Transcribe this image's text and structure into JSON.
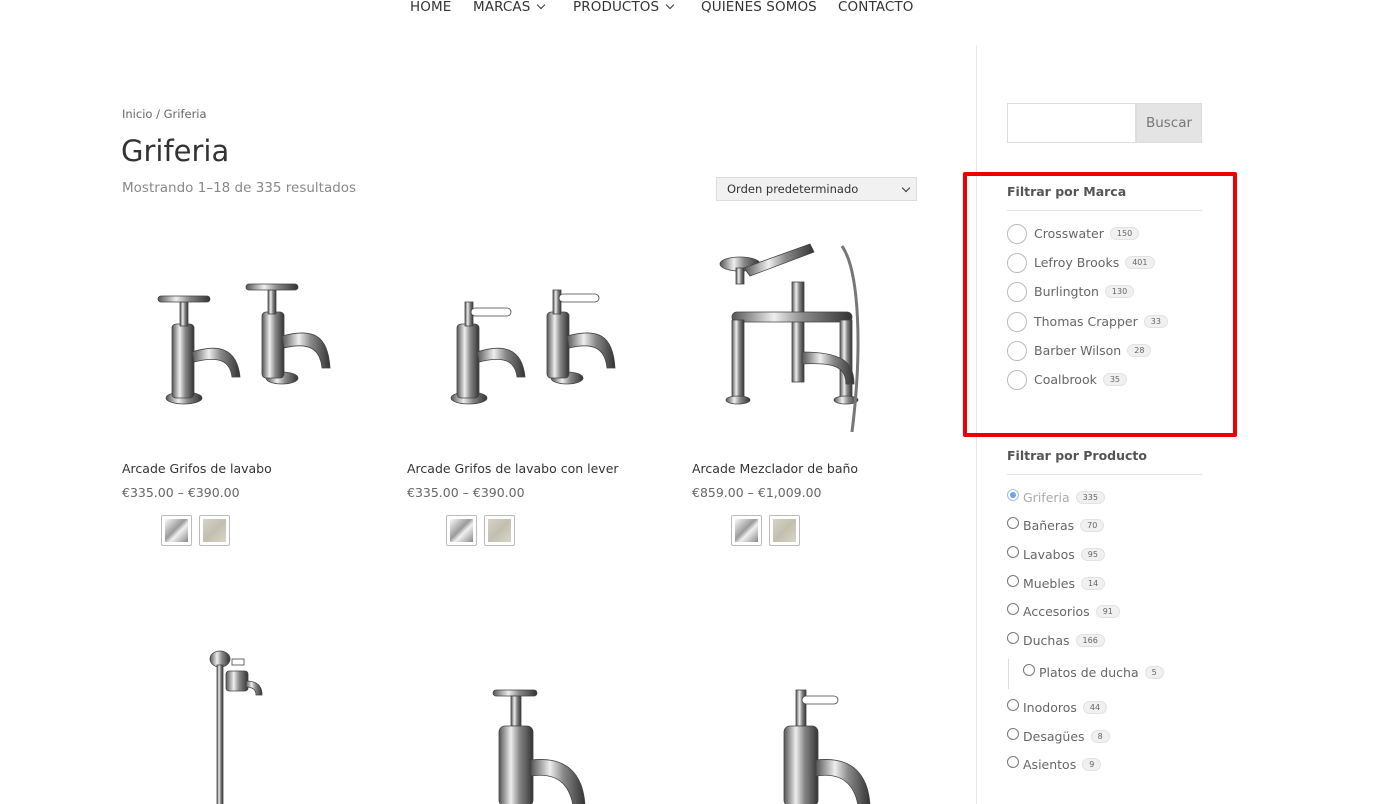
{
  "nav": {
    "items": [
      {
        "label": "HOME",
        "dropdown": false
      },
      {
        "label": "MARCAS",
        "dropdown": true
      },
      {
        "label": "PRODUCTOS",
        "dropdown": true
      },
      {
        "label": "QUIENES SOMOS",
        "dropdown": false
      },
      {
        "label": "CONTACTO",
        "dropdown": false
      }
    ]
  },
  "breadcrumb": "Inicio / Griferia",
  "page_title": "Griferia",
  "results_text": "Mostrando 1–18 de 335 resultados",
  "orderby": {
    "selected": "Orden predeterminado"
  },
  "products": [
    {
      "title": "Arcade Grifos de lavabo",
      "price": "€335.00 – €390.00",
      "swatches": [
        "chrome",
        "nickel"
      ]
    },
    {
      "title": "Arcade Grifos de lavabo con lever",
      "price": "€335.00 – €390.00",
      "swatches": [
        "chrome",
        "nickel"
      ]
    },
    {
      "title": "Arcade Mezclador de baño",
      "price": "€859.00 – €1,009.00",
      "swatches": [
        "chrome",
        "nickel"
      ]
    }
  ],
  "search": {
    "placeholder": "",
    "button_label": "Buscar"
  },
  "brand_filter": {
    "title": "Filtrar por Marca",
    "items": [
      {
        "label": "Crosswater",
        "count": "150"
      },
      {
        "label": "Lefroy Brooks",
        "count": "401"
      },
      {
        "label": "Burlington",
        "count": "130"
      },
      {
        "label": "Thomas Crapper",
        "count": "33"
      },
      {
        "label": "Barber Wilson",
        "count": "28"
      },
      {
        "label": "Coalbrook",
        "count": "35"
      }
    ]
  },
  "product_filter": {
    "title": "Filtrar por Producto",
    "items": [
      {
        "label": "Griferia",
        "count": "335",
        "checked": true
      },
      {
        "label": "Bañeras",
        "count": "70"
      },
      {
        "label": "Lavabos",
        "count": "95"
      },
      {
        "label": "Muebles",
        "count": "14"
      },
      {
        "label": "Accesorios",
        "count": "91"
      },
      {
        "label": "Duchas",
        "count": "166"
      },
      {
        "label": "Platos de ducha",
        "count": "5",
        "sub": true
      },
      {
        "label": "Inodoros",
        "count": "44"
      },
      {
        "label": "Desagües",
        "count": "8"
      },
      {
        "label": "Asientos",
        "count": "9"
      }
    ]
  },
  "colors": {
    "highlight": "#ee0000",
    "radio_checked": "#6ea4e8"
  }
}
